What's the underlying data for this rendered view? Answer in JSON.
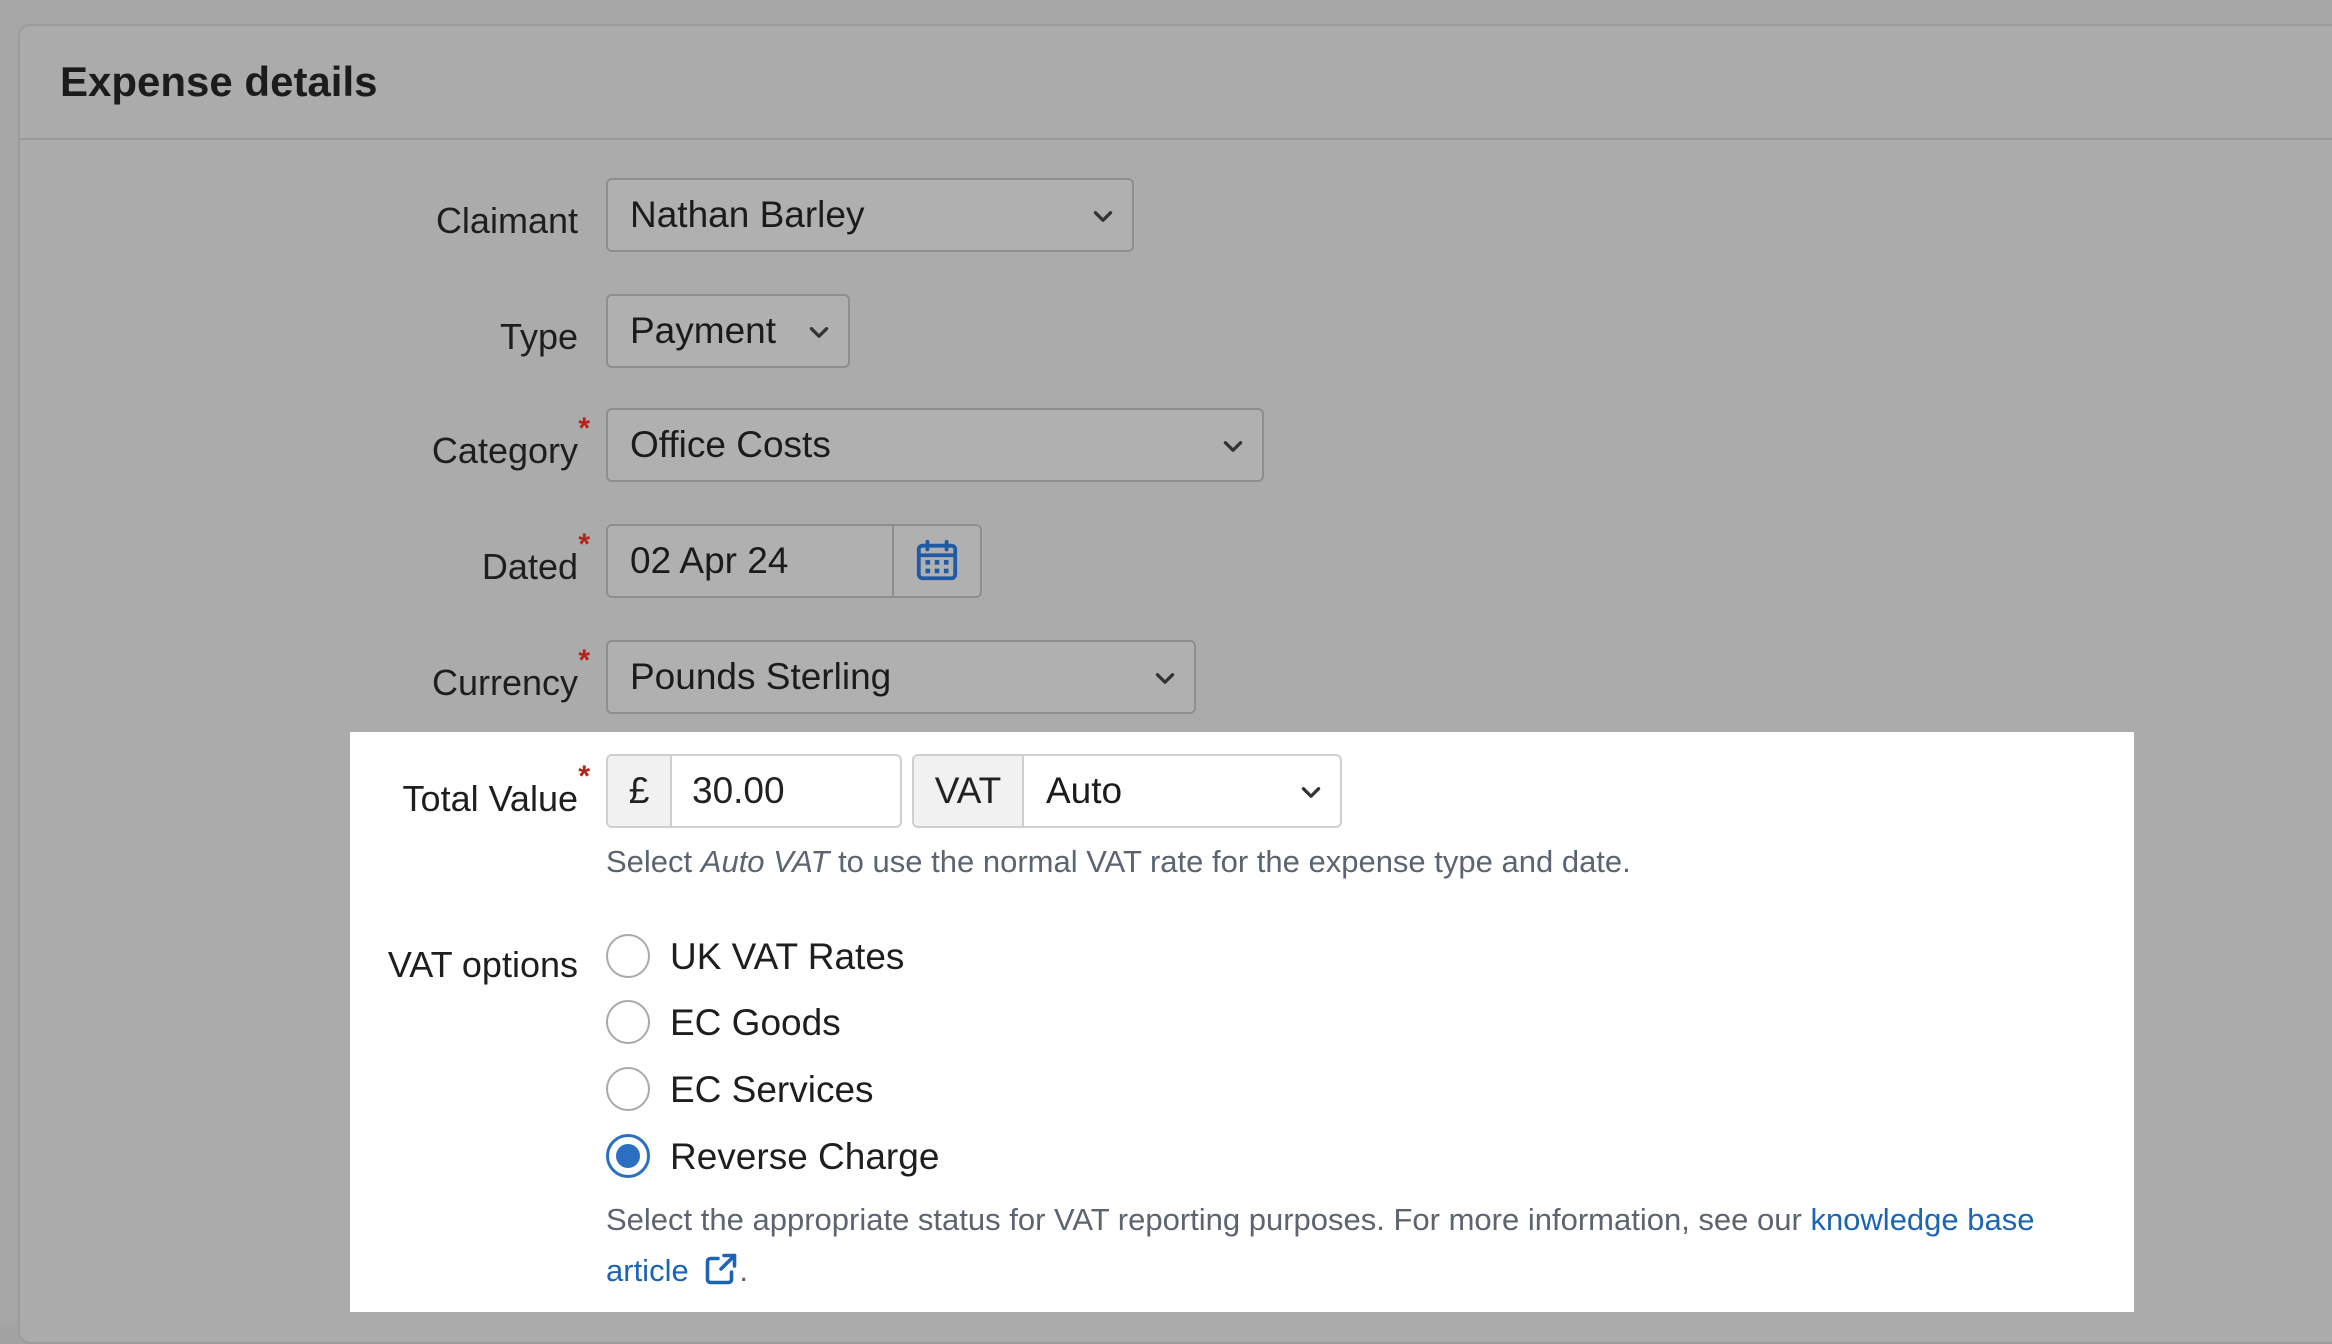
{
  "panel": {
    "title": "Expense details"
  },
  "form": {
    "claimant": {
      "label": "Claimant",
      "value": "Nathan Barley"
    },
    "type": {
      "label": "Type",
      "value": "Payment"
    },
    "category": {
      "label": "Category",
      "value": "Office Costs",
      "required": "*"
    },
    "dated": {
      "label": "Dated",
      "value": "02 Apr 24",
      "required": "*"
    },
    "currency": {
      "label": "Currency",
      "value": "Pounds Sterling",
      "required": "*"
    },
    "total_value": {
      "label": "Total Value",
      "required": "*",
      "currency_symbol": "£",
      "amount": "30.00",
      "vat_label": "VAT",
      "vat_value": "Auto",
      "help_prefix": "Select ",
      "help_emphasis": "Auto VAT",
      "help_suffix": " to use the normal VAT rate for the expense type and date."
    },
    "vat_options": {
      "label": "VAT options",
      "options": [
        {
          "label": "UK VAT Rates",
          "checked": false
        },
        {
          "label": "EC Goods",
          "checked": false
        },
        {
          "label": "EC Services",
          "checked": false
        },
        {
          "label": "Reverse Charge",
          "checked": true
        }
      ],
      "help_text": "Select the appropriate status for VAT reporting purposes. For more information, see our ",
      "link_part1": "knowledge base",
      "link_part2": "article",
      "help_end": "."
    }
  },
  "colors": {
    "accent": "#2a6fc0",
    "required": "#b42318",
    "link": "#1d64b5",
    "overlay": "#a6a6a6"
  },
  "icons": {
    "chevron": "chevron-down-icon",
    "calendar": "calendar-icon",
    "external": "external-link-icon"
  }
}
